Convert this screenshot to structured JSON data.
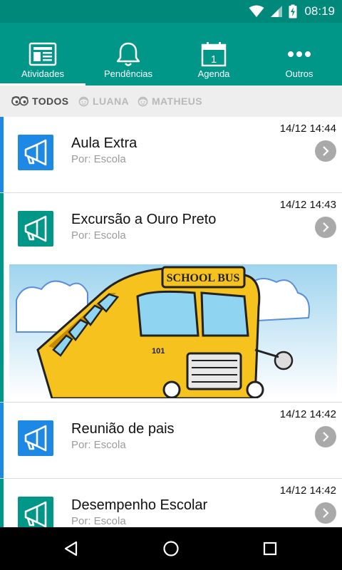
{
  "status_bar": {
    "time": "08:19"
  },
  "tabs": [
    {
      "label": "Atividades",
      "icon": "newspaper-icon",
      "active": true
    },
    {
      "label": "Pendências",
      "icon": "bell-icon",
      "active": false
    },
    {
      "label": "Agenda",
      "icon": "calendar-icon",
      "calendar_day": "1",
      "active": false
    },
    {
      "label": "Outros",
      "icon": "more-icon",
      "active": false
    }
  ],
  "filters": [
    {
      "label": "TODOS",
      "icon": "eyes-icon",
      "active": true
    },
    {
      "label": "LUANA",
      "icon": "face-icon",
      "active": false
    },
    {
      "label": "MATHEUS",
      "icon": "face-icon",
      "active": false
    }
  ],
  "feed": [
    {
      "title": "Aula Extra",
      "author": "Por: Escola",
      "time": "14/12 14:44",
      "color": "#1e88e5",
      "icon": "megaphone-icon"
    },
    {
      "title": "Excursão a Ouro Preto",
      "author": "Por: Escola",
      "time": "14/12 14:43",
      "color": "#009688",
      "icon": "megaphone-icon",
      "image": "school-bus-illustration",
      "image_text": "SCHOOL BUS",
      "image_number": "101"
    },
    {
      "title": "Reunião de pais",
      "author": "Por: Escola",
      "time": "14/12 14:42",
      "color": "#1e88e5",
      "icon": "megaphone-icon"
    },
    {
      "title": "Desempenho Escolar",
      "author": "Por: Escola",
      "time": "14/12 14:42",
      "color": "#009688",
      "icon": "megaphone-icon"
    }
  ],
  "colors": {
    "status_bar": "#00897b",
    "app_bar": "#009688",
    "filter_bg": "#eeeeee",
    "blue_accent": "#1e88e5",
    "teal_accent": "#009688",
    "chevron": "#a9a9a9",
    "nav_bar": "#000000"
  },
  "nav": [
    "back-icon",
    "home-icon",
    "recents-icon"
  ]
}
